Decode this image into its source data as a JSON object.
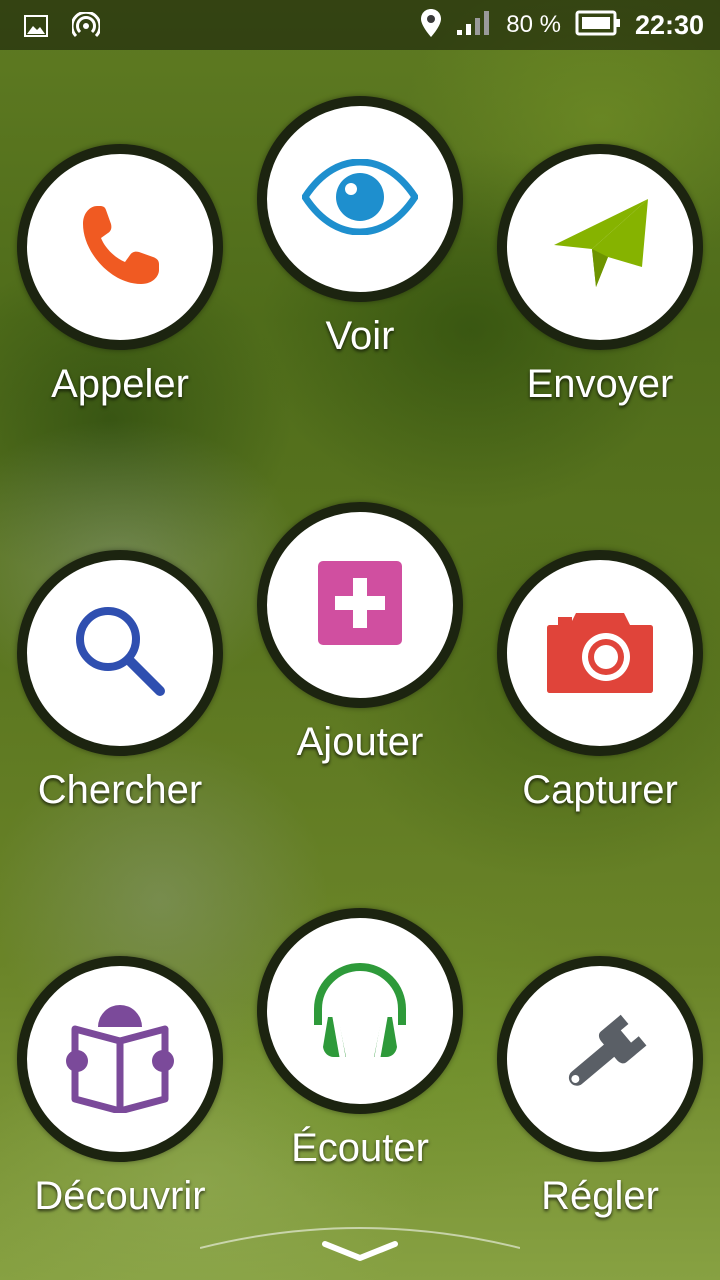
{
  "status_bar": {
    "battery_text": "80 %",
    "time": "22:30",
    "icons": [
      "image-notification-icon",
      "hotspot-icon",
      "location-icon",
      "signal-icon",
      "battery-icon"
    ]
  },
  "tiles": [
    {
      "id": "appeler",
      "label": "Appeler",
      "icon": "phone-icon",
      "color": "#f05a22"
    },
    {
      "id": "voir",
      "label": "Voir",
      "icon": "eye-icon",
      "color": "#1e8fce"
    },
    {
      "id": "envoyer",
      "label": "Envoyer",
      "icon": "paper-plane-icon",
      "color": "#86b300"
    },
    {
      "id": "chercher",
      "label": "Chercher",
      "icon": "search-icon",
      "color": "#2f4fb0"
    },
    {
      "id": "ajouter",
      "label": "Ajouter",
      "icon": "add-icon",
      "color": "#d04fa0"
    },
    {
      "id": "capturer",
      "label": "Capturer",
      "icon": "camera-icon",
      "color": "#e0443a"
    },
    {
      "id": "decouvrir",
      "label": "Découvrir",
      "icon": "reading-icon",
      "color": "#7b4a9a"
    },
    {
      "id": "ecouter",
      "label": "Écouter",
      "icon": "headphones-icon",
      "color": "#2e9a3a"
    },
    {
      "id": "regler",
      "label": "Régler",
      "icon": "wrench-icon",
      "color": "#5a5f66"
    }
  ],
  "bottom": {
    "icon": "chevron-down-icon"
  }
}
